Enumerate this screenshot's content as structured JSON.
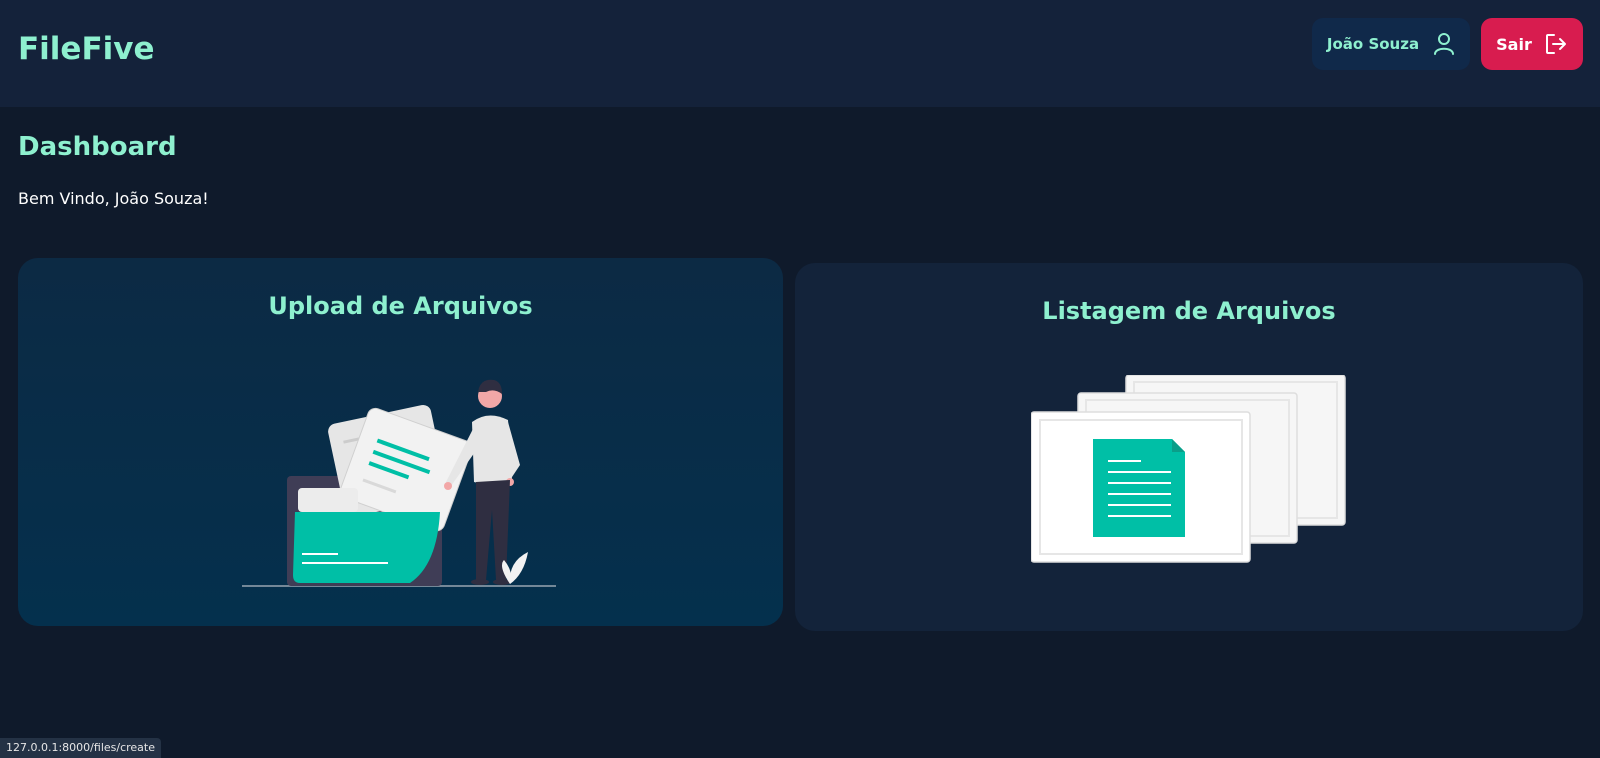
{
  "app": {
    "brand": "FileFive"
  },
  "header": {
    "user_name": "João Souza",
    "logout_label": "Sair"
  },
  "main": {
    "title": "Dashboard",
    "welcome": "Bem Vindo, João Souza!",
    "cards": [
      {
        "title": "Upload de Arquivos",
        "icon": "upload-files-illustration"
      },
      {
        "title": "Listagem de Arquivos",
        "icon": "file-list-illustration"
      }
    ]
  },
  "statusbar": {
    "url": "127.0.0.1:8000/files/create"
  },
  "colors": {
    "background": "#0f1a2b",
    "header": "#14223a",
    "accent": "#8ef0cf",
    "danger": "#d81c4f",
    "teal": "#00bfa6"
  }
}
